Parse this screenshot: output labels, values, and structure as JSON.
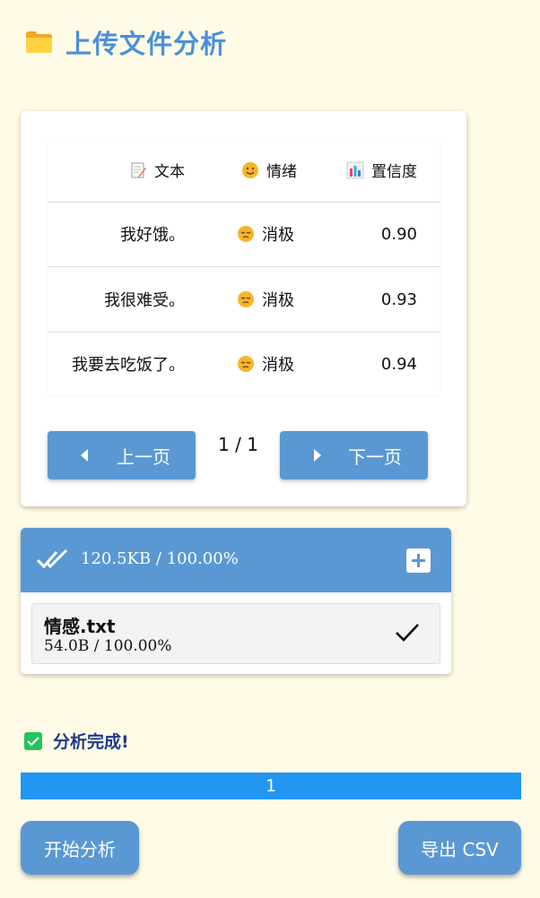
{
  "header": {
    "icon": "folder-icon",
    "title": "上传文件分析"
  },
  "table": {
    "columns": [
      {
        "label": "文本",
        "icon": "memo-icon"
      },
      {
        "label": "情绪",
        "icon": "smile-icon"
      },
      {
        "label": "置信度",
        "icon": "bar-chart-icon"
      }
    ],
    "rows": [
      {
        "text": "我好饿。",
        "emotion": "消极",
        "emotion_icon": "pensive-face-icon",
        "confidence": "0.90"
      },
      {
        "text": "我很难受。",
        "emotion": "消极",
        "emotion_icon": "pensive-face-icon",
        "confidence": "0.93"
      },
      {
        "text": "我要去吃饭了。",
        "emotion": "消极",
        "emotion_icon": "pensive-face-icon",
        "confidence": "0.94"
      }
    ]
  },
  "pagination": {
    "prev_label": "上一页",
    "next_label": "下一页",
    "page_indicator": "1 / 1"
  },
  "upload": {
    "total_stat": "120.5KB / 100.00%",
    "file": {
      "name": "情感.txt",
      "stat": "54.0B / 100.00%"
    }
  },
  "status": {
    "text": "分析完成!"
  },
  "progress": {
    "label": "1",
    "value": 1.0
  },
  "actions": {
    "start_label": "开始分析",
    "export_label": "导出 CSV"
  },
  "colors": {
    "accent": "#5A98D4",
    "title": "#4A90D9",
    "progress": "#2196F3",
    "success": "#22C55E",
    "background": "#FFFBE6"
  }
}
